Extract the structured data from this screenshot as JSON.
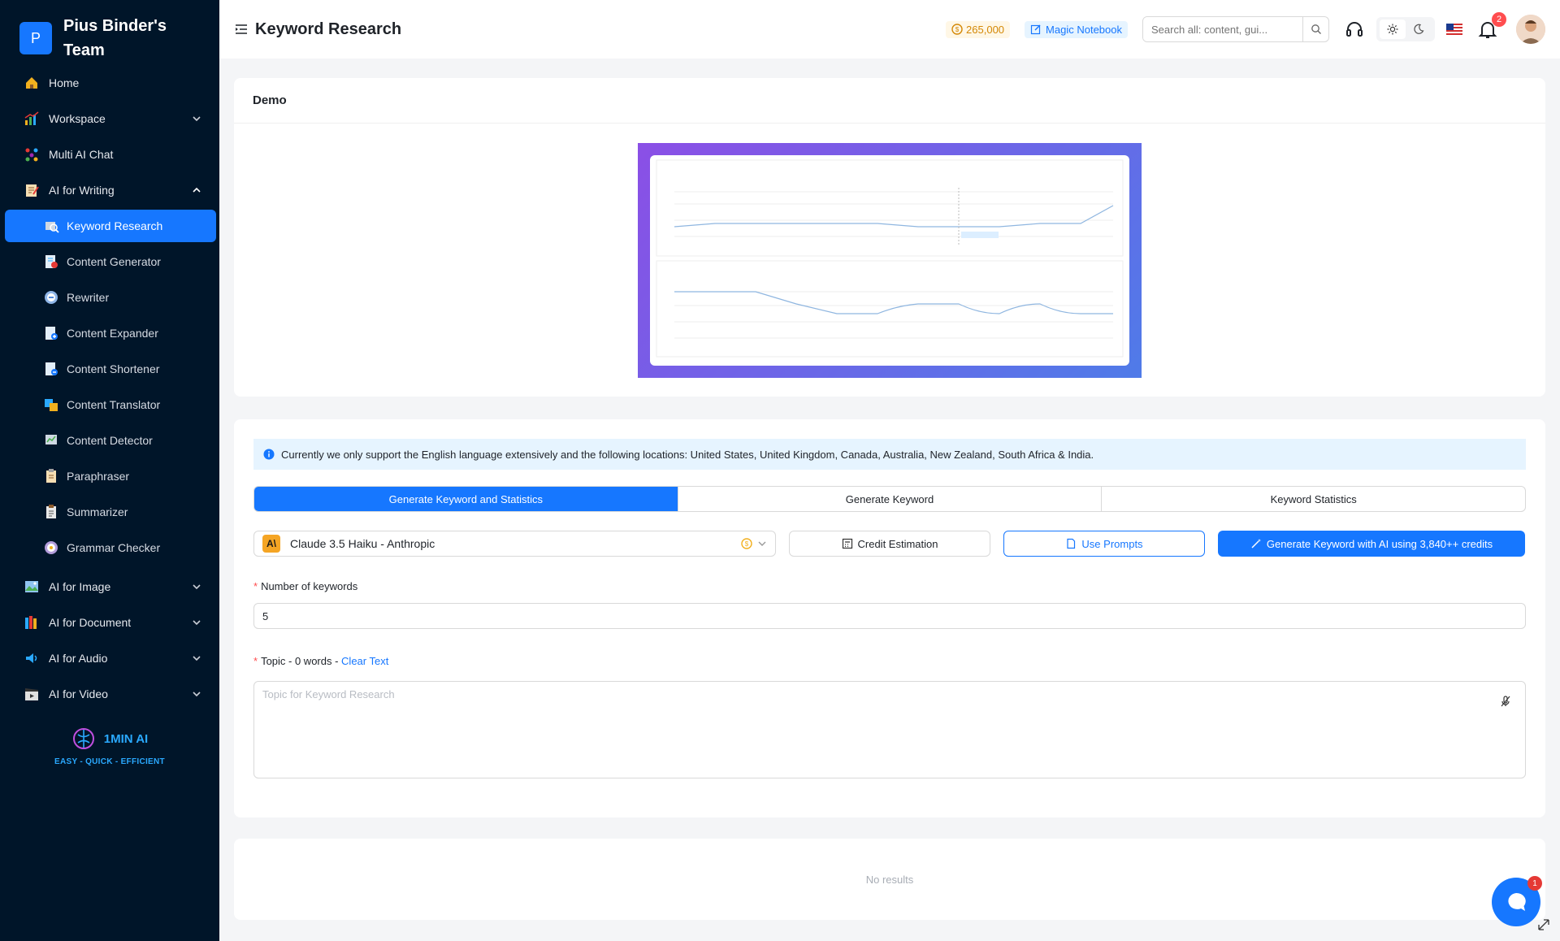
{
  "team": {
    "initial": "P",
    "name": "Pius Binder's Team"
  },
  "sidebar": {
    "items": [
      {
        "label": "Home",
        "icon": "home-icon"
      },
      {
        "label": "Workspace",
        "icon": "workspace-icon"
      },
      {
        "label": "Multi AI Chat",
        "icon": "multi-chat-icon"
      },
      {
        "label": "AI for Writing",
        "icon": "writing-icon"
      }
    ],
    "writing_sub": [
      {
        "label": "Keyword Research",
        "icon": "keyword-research-icon"
      },
      {
        "label": "Content Generator",
        "icon": "content-generator-icon"
      },
      {
        "label": "Rewriter",
        "icon": "rewriter-icon"
      },
      {
        "label": "Content Expander",
        "icon": "content-expander-icon"
      },
      {
        "label": "Content Shortener",
        "icon": "content-shortener-icon"
      },
      {
        "label": "Content Translator",
        "icon": "content-translator-icon"
      },
      {
        "label": "Content Detector",
        "icon": "content-detector-icon"
      },
      {
        "label": "Paraphraser",
        "icon": "paraphraser-icon"
      },
      {
        "label": "Summarizer",
        "icon": "summarizer-icon"
      },
      {
        "label": "Grammar Checker",
        "icon": "grammar-checker-icon"
      }
    ],
    "groups": [
      {
        "label": "AI for Image",
        "icon": "image-icon"
      },
      {
        "label": "AI for Document",
        "icon": "document-icon"
      },
      {
        "label": "AI for Audio",
        "icon": "audio-icon"
      },
      {
        "label": "AI for Video",
        "icon": "video-icon"
      }
    ],
    "brand": {
      "name": "1MIN AI",
      "tagline": "EASY - QUICK - EFFICIENT"
    }
  },
  "header": {
    "title": "Keyword Research",
    "credits": "265,000",
    "notebook": "Magic Notebook",
    "search_placeholder": "Search all: content, gui...",
    "notification_count": "2"
  },
  "demo": {
    "title": "Demo"
  },
  "form": {
    "notice": "Currently we only support the English language extensively and the following locations: United States, United Kingdom, Canada, Australia, New Zealand, South Africa & India.",
    "tabs": [
      "Generate Keyword and Statistics",
      "Generate Keyword",
      "Keyword Statistics"
    ],
    "model": "Claude 3.5 Haiku - Anthropic",
    "model_logo": "A\\",
    "credit_estimation": "Credit Estimation",
    "use_prompts": "Use Prompts",
    "generate": "Generate Keyword with AI using 3,840++ credits",
    "num_label": "Number of keywords",
    "num_value": "5",
    "topic_label": "Topic - 0 words - ",
    "clear_text": "Clear Text",
    "topic_placeholder": "Topic for Keyword Research"
  },
  "results": {
    "empty": "No results"
  },
  "chat": {
    "badge": "1"
  },
  "colors": {
    "primary": "#1677ff",
    "sidebar_bg": "#001529",
    "credits": "#d48806"
  }
}
